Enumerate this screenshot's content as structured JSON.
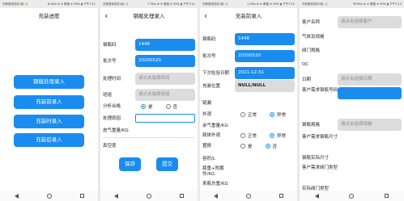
{
  "screens": {
    "progress": {
      "status_left": "完美搬家插件(韩) 🔋",
      "status_right": "8.2K/s ⊕ ✆ 奇迹 ⊘ 59% ▮ 下午7:11",
      "title": "充装进度",
      "menu": [
        "钢瓶处理录入",
        "充装前录入",
        "充装时录入",
        "充装后录入"
      ]
    },
    "process": {
      "status_left": "完美搬家插件(韩) 🔋",
      "status_right": "7.7K/s ⊕ ✆ 奇迹 ⊘ 59% ▮ 下午7:12",
      "back": "‹",
      "title": "钢瓶处理录入",
      "fields": {
        "cylinder_code_label": "钢瓶码",
        "cylinder_code": "1448",
        "batch_label": "批次号",
        "batch": "20200520",
        "time_label": "处理时间",
        "time_placeholder": "请点击选择时间",
        "team_label": "班组",
        "team_placeholder": "请点击选择班组",
        "qualified_label": "分析合格",
        "yes": "是",
        "no": "否",
        "reason_label": "处理原因",
        "tare_label": "皮气重量/KG",
        "vacuum_label": "真空度"
      },
      "save": "保存",
      "submit": "提交"
    },
    "precharge": {
      "status_left": "完美搬家插件(韩) 🔋",
      "status_right": "1.7K/s ⊕ ✆ 奇迹 ⊘ 59% ▮ 下午7:12",
      "back": "‹",
      "title": "充装前录入",
      "fields": {
        "cylinder_code_label": "钢瓶码",
        "cylinder_code": "1448",
        "batch_label": "批次号",
        "batch": "20200520",
        "next_check_label": "下次检验日期",
        "next_check": "2021-12-31",
        "location_label": "充装位置",
        "location": "NULL/NULL",
        "leak_label": "链漏",
        "appearance_label": "外观",
        "normal": "正常",
        "abnormal": "异常",
        "residual_label": "余气重量/KG",
        "residual_type_label": "瓶体外观",
        "replace_label": "置换",
        "yes": "是",
        "no": "否",
        "volume_label": "容积/L",
        "tare_label": "瓶重+附属件/KG",
        "total_label": "来瓶总重/KG"
      }
    },
    "customer": {
      "status_left": "完美搬家插件(韩) 🔋",
      "status_right": "397K/s ⊕ ✆ 奇迹 ⊘ 59% ▮ 下午7:12",
      "fields": {
        "customer_label": "客户名称",
        "customer_placeholder": "请点击选择客户",
        "gas_label": "气体及规格",
        "valve_label": "阀门规格",
        "qc_label": "QC",
        "date_label": "日期",
        "date_placeholder": "请点击选择日期",
        "code_label": "客户需求钢瓶号码",
        "spec_label": "钢瓶规格",
        "spec_placeholder": "请点击选择规格",
        "size_label": "客户需求钢瓶尺寸",
        "actual_size_label": "钢瓶实际尺寸",
        "valve_type_label": "客户需求阀门类型",
        "actual_valve_label": "实际阀门类型"
      }
    }
  },
  "colors": {
    "accent": "#1a8cf0",
    "field_gray": "#dcdcdc"
  },
  "icons": [
    "nav-back-icon",
    "nav-home-icon",
    "nav-recent-icon",
    "radio-icon"
  ]
}
